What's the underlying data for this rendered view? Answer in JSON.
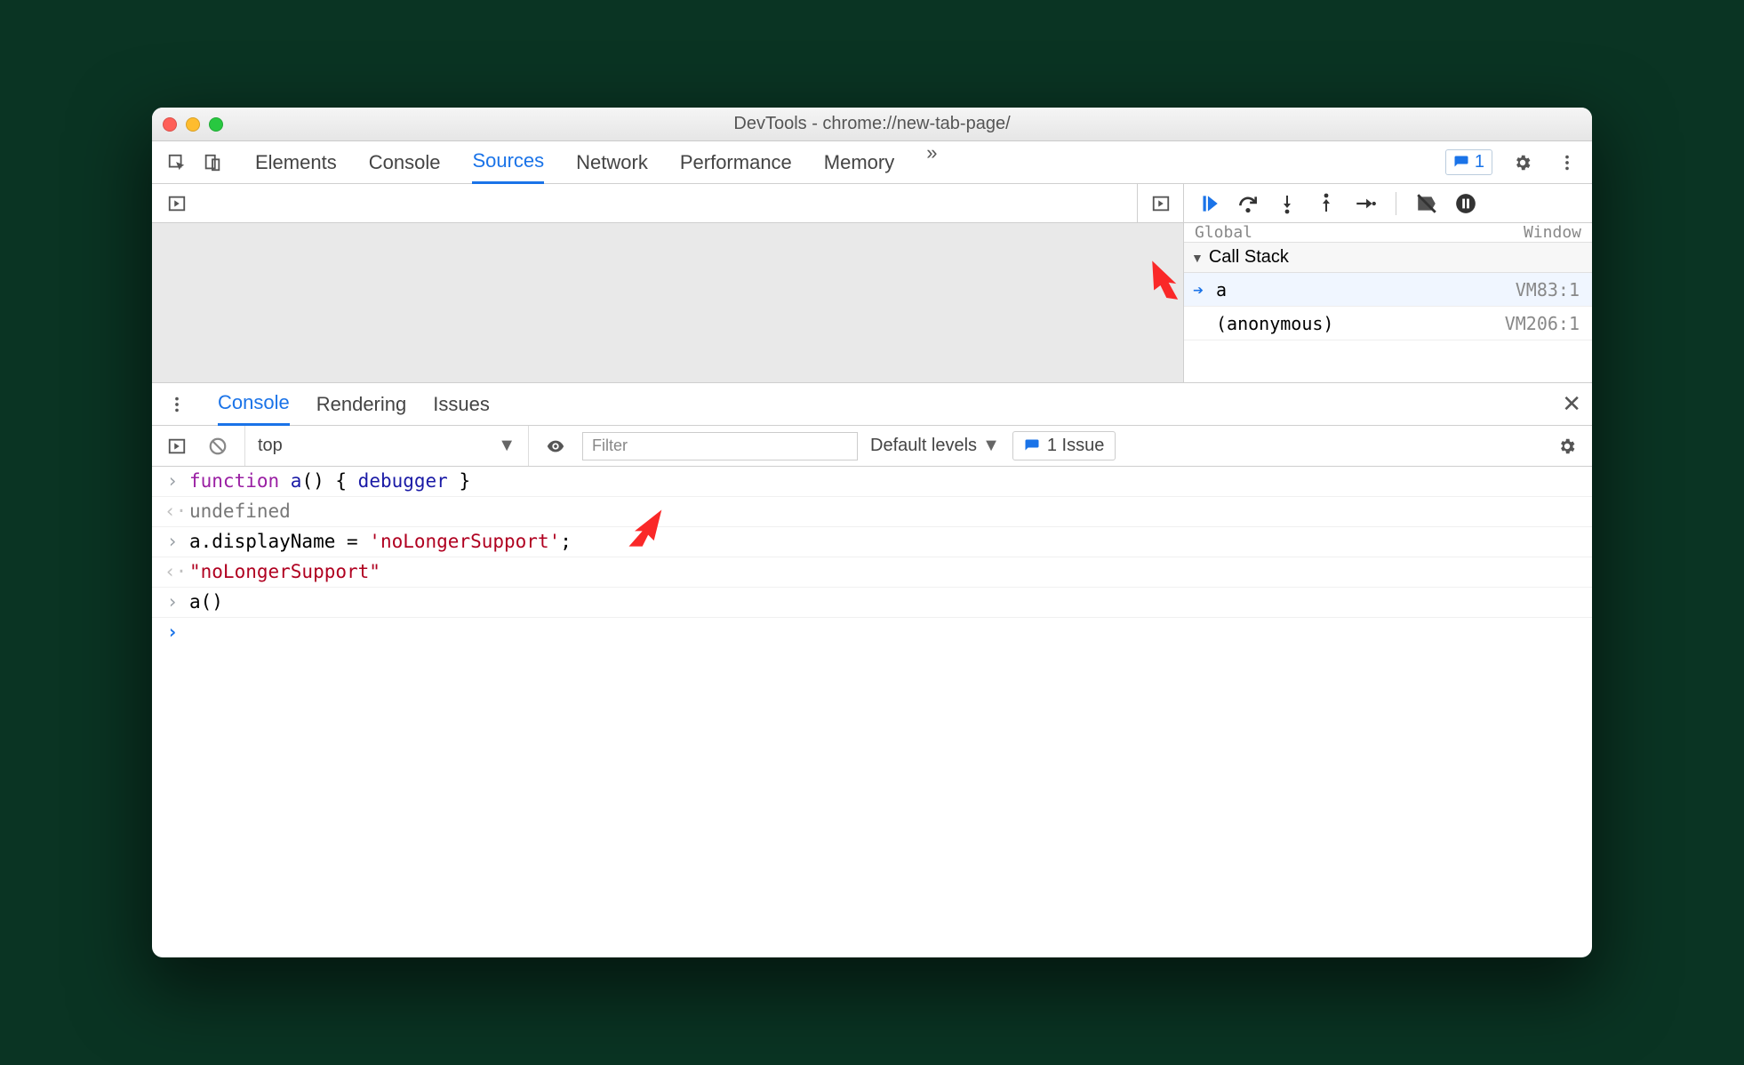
{
  "window": {
    "title": "DevTools - chrome://new-tab-page/"
  },
  "mainTabs": {
    "items": [
      "Elements",
      "Console",
      "Sources",
      "Network",
      "Performance",
      "Memory"
    ],
    "active": "Sources",
    "issueBadge": "1"
  },
  "scopePartial": {
    "left": "  Global",
    "right": "Window"
  },
  "callStack": {
    "header": "Call Stack",
    "frames": [
      {
        "name": "a",
        "location": "VM83:1",
        "current": true
      },
      {
        "name": "(anonymous)",
        "location": "VM206:1",
        "current": false
      }
    ]
  },
  "drawer": {
    "tabs": [
      "Console",
      "Rendering",
      "Issues"
    ],
    "active": "Console"
  },
  "consoleToolbar": {
    "context": "top",
    "filterPlaceholder": "Filter",
    "levels": "Default levels",
    "issues": "1 Issue"
  },
  "console": {
    "lines": {
      "l0_kw": "function",
      "l0_fn": " a",
      "l0_rest1": "() { ",
      "l0_dbg": "debugger",
      "l0_rest2": " }",
      "l1": "undefined",
      "l2_pre": "a.displayName = ",
      "l2_str": "'noLongerSupport'",
      "l2_post": ";",
      "l3": "\"noLongerSupport\"",
      "l4": "a()"
    }
  }
}
